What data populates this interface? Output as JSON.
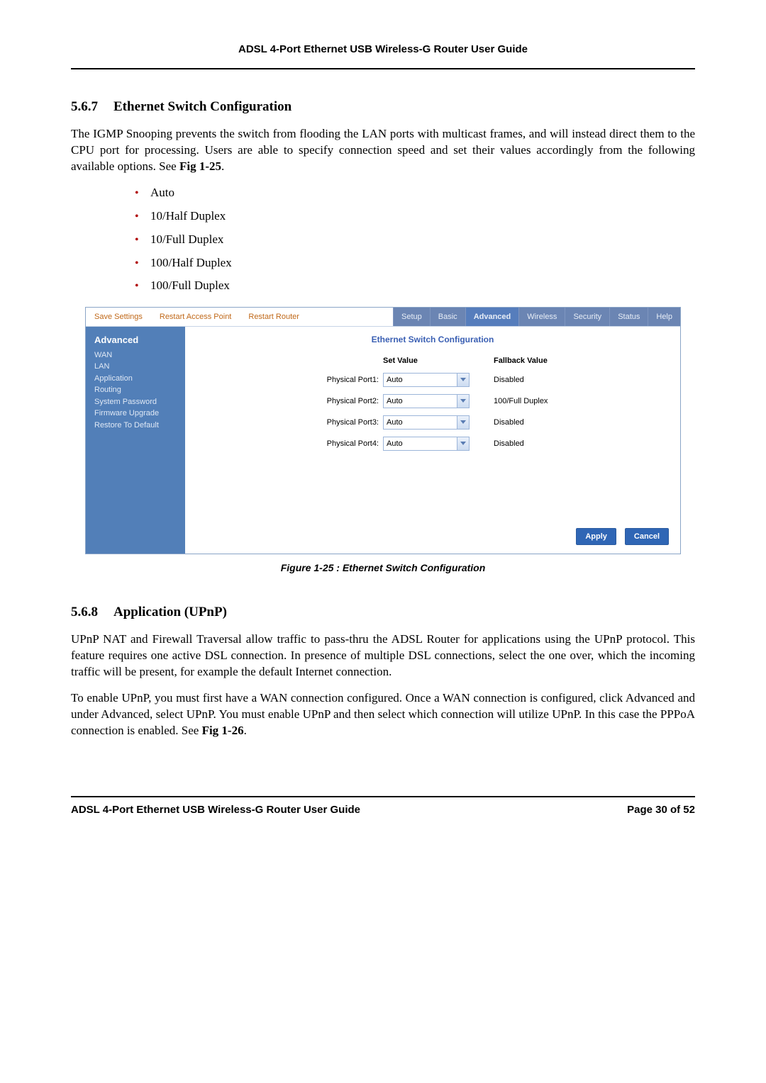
{
  "header": "ADSL 4-Port Ethernet USB Wireless-G Router User Guide",
  "section1": {
    "num": "5.6.7",
    "title": "Ethernet Switch Configuration",
    "para1_a": "The IGMP Snooping prevents the switch from flooding the LAN ports with multicast frames, and will instead direct them to the CPU port for processing. Users are able to specify connection speed and set their values accordingly from the following available options. See ",
    "para1_ref": "Fig 1-25",
    "para1_b": ".",
    "bullets": [
      "Auto",
      "10/Half Duplex",
      "10/Full Duplex",
      "100/Half Duplex",
      "100/Full Duplex"
    ]
  },
  "router": {
    "toplinks": [
      "Save Settings",
      "Restart Access Point",
      "Restart Router"
    ],
    "tabs": [
      "Setup",
      "Basic",
      "Advanced",
      "Wireless",
      "Security",
      "Status",
      "Help"
    ],
    "active_tab_index": 2,
    "side_cat": "Advanced",
    "side_items": [
      "WAN",
      "LAN",
      "Application",
      "Routing",
      "System Password",
      "Firmware Upgrade",
      "Restore To Default"
    ],
    "panel_title": "Ethernet Switch Configuration",
    "col_set": "Set Value",
    "col_fallback": "Fallback Value",
    "ports": [
      {
        "label": "Physical Port1:",
        "value": "Auto",
        "fallback": "Disabled"
      },
      {
        "label": "Physical Port2:",
        "value": "Auto",
        "fallback": "100/Full Duplex"
      },
      {
        "label": "Physical Port3:",
        "value": "Auto",
        "fallback": "Disabled"
      },
      {
        "label": "Physical Port4:",
        "value": "Auto",
        "fallback": "Disabled"
      }
    ],
    "apply": "Apply",
    "cancel": "Cancel"
  },
  "figure_caption": "Figure 1-25 : Ethernet Switch Configuration",
  "section2": {
    "num": "5.6.8",
    "title": "Application (UPnP)",
    "para1": "UPnP NAT and Firewall Traversal allow traffic to pass-thru the ADSL Router for applications using the UPnP protocol. This feature requires one active DSL connection. In presence of multiple DSL connections, select the one over, which the incoming traffic will be present, for example the default Internet connection.",
    "para2_a": "To enable UPnP, you must first have a WAN connection configured. Once a WAN connection is configured, click Advanced and under Advanced, select UPnP. You must enable UPnP and then select which connection will utilize UPnP. In this case the PPPoA connection is enabled. See ",
    "para2_ref": "Fig 1-26",
    "para2_b": "."
  },
  "footer": {
    "left": "ADSL 4-Port Ethernet USB Wireless-G Router User Guide",
    "right": "Page 30 of 52"
  }
}
